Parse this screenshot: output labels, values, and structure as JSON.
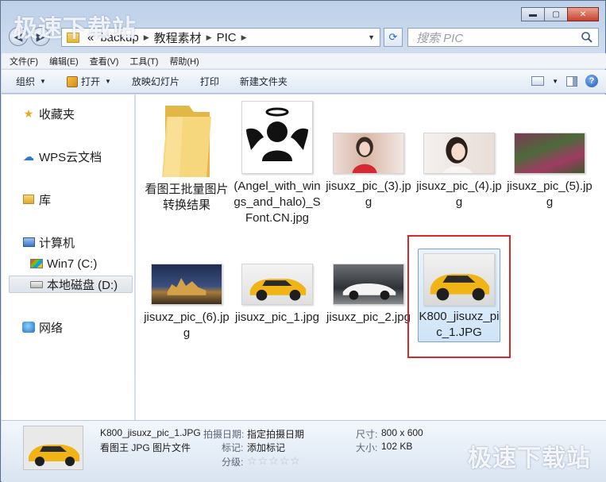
{
  "watermark": "极速下载站",
  "window": {
    "minimize": "▬",
    "maximize": "▢",
    "close": "✕"
  },
  "address": {
    "prefix": "«",
    "crumbs": [
      "backup",
      "教程素材",
      "PIC"
    ],
    "search_placeholder": "搜索 PIC"
  },
  "menu": [
    "文件(F)",
    "编辑(E)",
    "查看(V)",
    "工具(T)",
    "帮助(H)"
  ],
  "toolbar": {
    "organize": "组织",
    "open": "打开",
    "slideshow": "放映幻灯片",
    "print": "打印",
    "new_folder": "新建文件夹"
  },
  "sidebar": {
    "favorites": "收藏夹",
    "wps": "WPS云文档",
    "library": "库",
    "computer": "计算机",
    "drive_c": "Win7 (C:)",
    "drive_d": "本地磁盘 (D:)",
    "network": "网络"
  },
  "files": [
    {
      "name": "看图王批量图片转换结果",
      "type": "folder"
    },
    {
      "name": "(Angel_with_wings_and_halo)_SFont.CN.jpg",
      "type": "angel"
    },
    {
      "name": "jisuxz_pic_(3).jpg",
      "type": "girl-red"
    },
    {
      "name": "jisuxz_pic_(4).jpg",
      "type": "girl-white"
    },
    {
      "name": "jisuxz_pic_(5).jpg",
      "type": "flowers"
    },
    {
      "name": "jisuxz_pic_(6).jpg",
      "type": "castle"
    },
    {
      "name": "jisuxz_pic_1.jpg",
      "type": "suv"
    },
    {
      "name": "jisuxz_pic_2.jpg",
      "type": "white-car"
    },
    {
      "name": "K800_jisuxz_pic_1.JPG",
      "type": "suv"
    }
  ],
  "details": {
    "filename": "K800_jisuxz_pic_1.JPG",
    "filetype": "看图王 JPG 图片文件",
    "date_label": "拍摄日期:",
    "date_value": "指定拍摄日期",
    "tags_label": "标记:",
    "tags_value": "添加标记",
    "rating_label": "分级:",
    "rating_stars": 0,
    "size_label": "尺寸:",
    "size_value": "800 x 600",
    "filesize_label": "大小:",
    "filesize_value": "102 KB"
  },
  "colors": {
    "selection_border": "#7da2ce",
    "highlight_red": "#d9262a",
    "suv_yellow": "#f0b417"
  }
}
